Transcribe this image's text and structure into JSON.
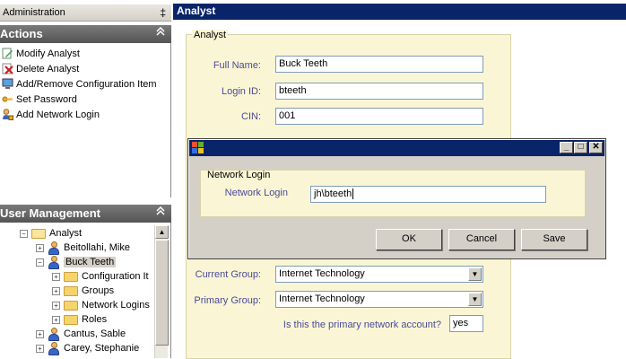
{
  "admin": {
    "title": "Administration",
    "pin": "‡"
  },
  "actions": {
    "title": "Actions",
    "collapse": "»",
    "items": [
      {
        "label": "Modify Analyst",
        "icon": "pencil-icon"
      },
      {
        "label": "Delete Analyst",
        "icon": "delete-x-icon"
      },
      {
        "label": "Add/Remove Configuration Item",
        "icon": "computer-icon"
      },
      {
        "label": "Set Password",
        "icon": "key-icon"
      },
      {
        "label": "Add Network Login",
        "icon": "user-lock-icon"
      }
    ]
  },
  "user_management": {
    "title": "User Management",
    "collapse": "»",
    "tree": {
      "root": "Analyst",
      "users": [
        "Beitollahi, Mike",
        "Buck Teeth",
        "Cantus, Sable",
        "Carey, Stephanie"
      ],
      "children": [
        "Configuration It",
        "Groups",
        "Network Logins",
        "Roles"
      ]
    }
  },
  "main": {
    "title": "Analyst",
    "group_label": "Analyst",
    "fields": {
      "full_name": {
        "label": "Full Name:",
        "value": "Buck Teeth"
      },
      "login_id": {
        "label": "Login ID:",
        "value": "bteeth"
      },
      "cin": {
        "label": "CIN:",
        "value": "001"
      },
      "current_group": {
        "label": "Current Group:",
        "value": "Internet Technology"
      },
      "primary_group": {
        "label": "Primary Group:",
        "value": "Internet Technology"
      },
      "primary_network": {
        "label": "Is this the primary network account?",
        "value": "yes"
      }
    }
  },
  "dialog": {
    "group_label": "Network Login",
    "field_label": "Network Login",
    "field_value": "jh\\bteeth",
    "buttons": {
      "ok": "OK",
      "cancel": "Cancel",
      "save": "Save"
    }
  }
}
